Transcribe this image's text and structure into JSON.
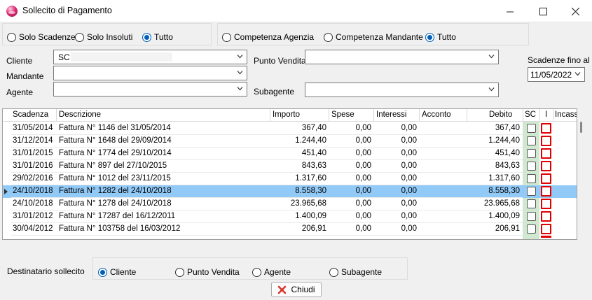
{
  "window": {
    "title": "Sollecito di Pagamento",
    "controls": {
      "minimize": "—",
      "maximize": "☐",
      "close": "✕"
    }
  },
  "filter_scadenze": {
    "options": [
      "Solo Scadenze",
      "Solo Insoluti",
      "Tutto"
    ],
    "selected": "Tutto"
  },
  "filter_competenza": {
    "options": [
      "Competenza Agenzia",
      "Competenza Mandante",
      "Tutto"
    ],
    "selected": "Tutto"
  },
  "form": {
    "cliente_label": "Cliente",
    "cliente_value": "SC",
    "mandante_label": "Mandante",
    "mandante_value": "",
    "agente_label": "Agente",
    "agente_value": "",
    "punto_vendita_label": "Punto Vendita",
    "punto_vendita_value": "",
    "subagente_label": "Subagente",
    "subagente_value": "",
    "scadenze_label": "Scadenze fino al",
    "scadenze_value": "11/05/2022"
  },
  "grid": {
    "columns": [
      "Scadenza",
      "Descrizione",
      "Importo",
      "Spese",
      "Interessi",
      "Acconto",
      "Debito",
      "SC",
      "I",
      "Incass"
    ],
    "rows": [
      {
        "scadenza": "31/05/2014",
        "descrizione": "Fattura N° 1146 del 31/05/2014",
        "importo": "367,40",
        "spese": "0,00",
        "interessi": "0,00",
        "acconto": "",
        "debito": "367,40",
        "selected": false
      },
      {
        "scadenza": "31/12/2014",
        "descrizione": "Fattura N° 1648 del 29/09/2014",
        "importo": "1.244,40",
        "spese": "0,00",
        "interessi": "0,00",
        "acconto": "",
        "debito": "1.244,40",
        "selected": false
      },
      {
        "scadenza": "31/01/2015",
        "descrizione": "Fattura N° 1774 del 29/10/2014",
        "importo": "451,40",
        "spese": "0,00",
        "interessi": "0,00",
        "acconto": "",
        "debito": "451,40",
        "selected": false
      },
      {
        "scadenza": "31/01/2016",
        "descrizione": "Fattura N° 897 del 27/10/2015",
        "importo": "843,63",
        "spese": "0,00",
        "interessi": "0,00",
        "acconto": "",
        "debito": "843,63",
        "selected": false
      },
      {
        "scadenza": "29/02/2016",
        "descrizione": "Fattura N° 1012 del 23/11/2015",
        "importo": "1.317,60",
        "spese": "0,00",
        "interessi": "0,00",
        "acconto": "",
        "debito": "1.317,60",
        "selected": false
      },
      {
        "scadenza": "24/10/2018",
        "descrizione": "Fattura N° 1282 del 24/10/2018",
        "importo": "8.558,30",
        "spese": "0,00",
        "interessi": "0,00",
        "acconto": "",
        "debito": "8.558,30",
        "selected": true
      },
      {
        "scadenza": "24/10/2018",
        "descrizione": "Fattura N° 1278 del 24/10/2018",
        "importo": "23.965,68",
        "spese": "0,00",
        "interessi": "0,00",
        "acconto": "",
        "debito": "23.965,68",
        "selected": false
      },
      {
        "scadenza": "31/01/2012",
        "descrizione": "Fattura N° 17287 del 16/12/2011",
        "importo": "1.400,09",
        "spese": "0,00",
        "interessi": "0,00",
        "acconto": "",
        "debito": "1.400,09",
        "selected": false
      },
      {
        "scadenza": "30/04/2012",
        "descrizione": "Fattura N° 103758 del 16/03/2012",
        "importo": "206,91",
        "spese": "0,00",
        "interessi": "0,00",
        "acconto": "",
        "debito": "206,91",
        "selected": false
      }
    ]
  },
  "destinatario": {
    "label": "Destinatario sollecito",
    "options": [
      "Cliente",
      "Punto Vendita",
      "Agente",
      "Subagente"
    ],
    "selected": "Cliente"
  },
  "footer": {
    "close_label": "Chiudi"
  },
  "colors": {
    "selected_row": "#91c9f7",
    "sc_column": "#cfe8cf",
    "i_checkbox_border": "#e00000",
    "radio_accent": "#005fb8"
  }
}
